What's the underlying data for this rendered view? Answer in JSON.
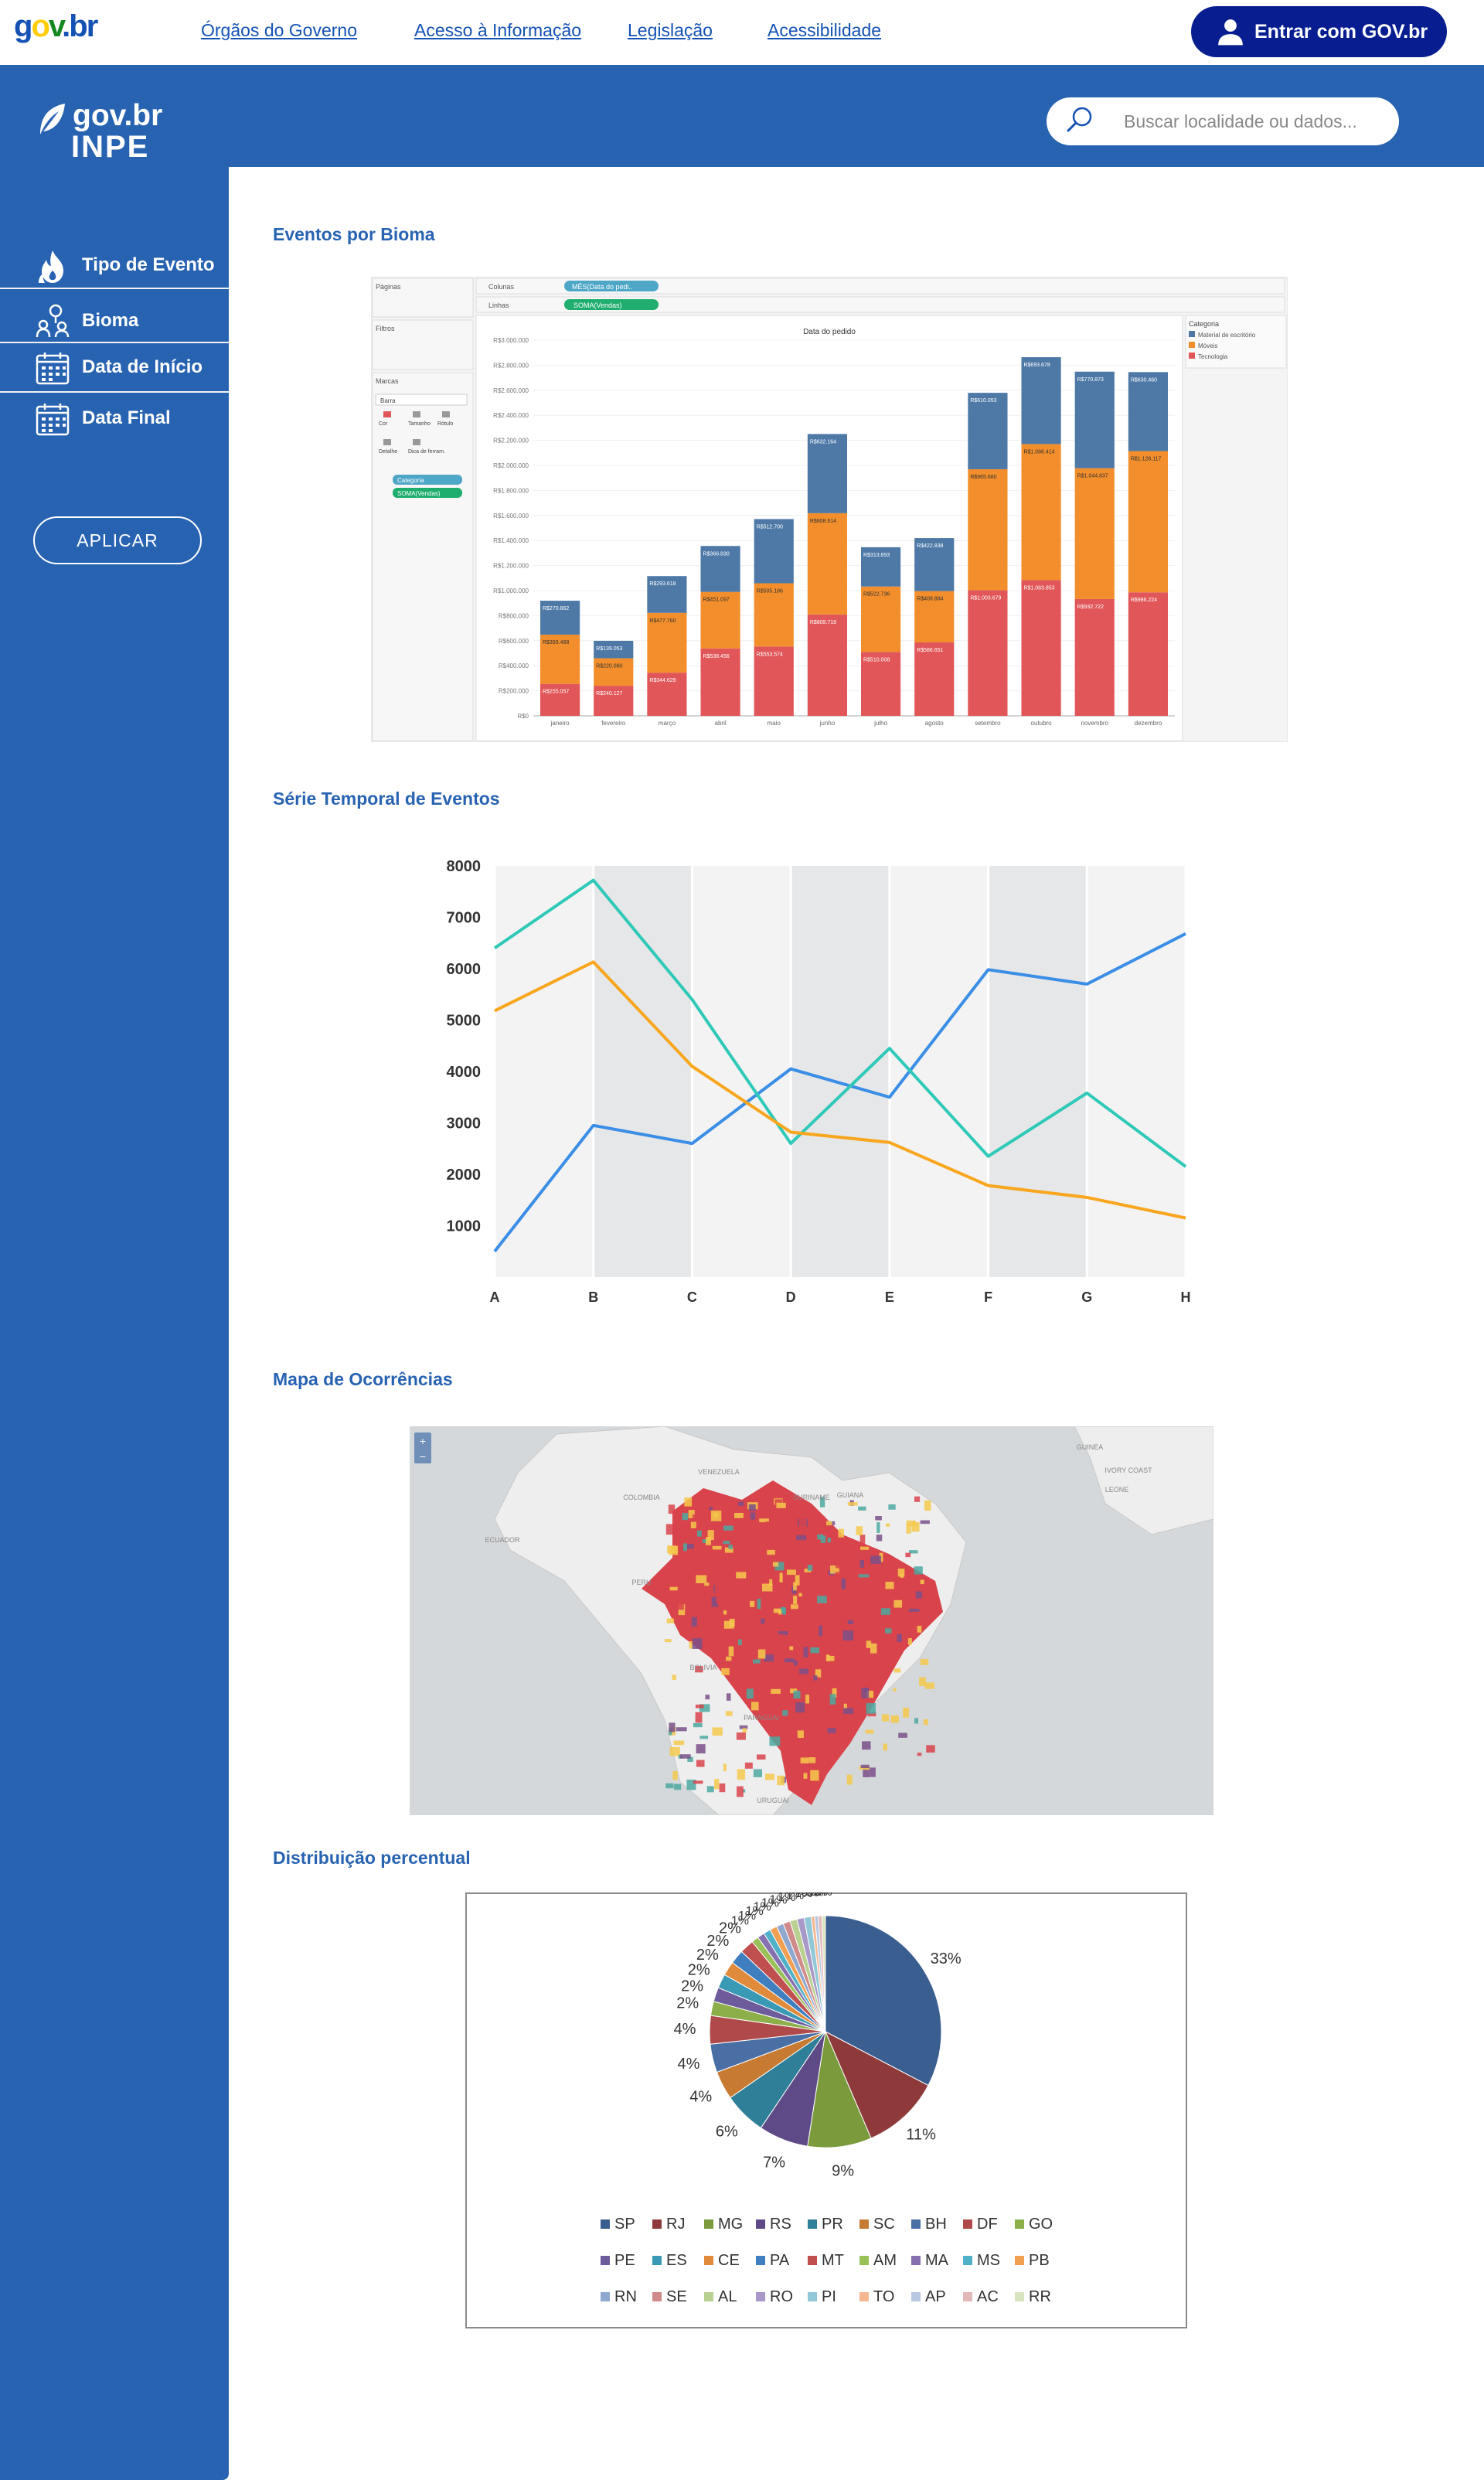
{
  "topbar": {
    "logo": {
      "g": "g",
      "o": "o",
      "v": "v",
      "b": ".br"
    },
    "links": [
      "Órgãos do Governo",
      "Acesso à Informação",
      "Legislação",
      "Acessibilidade"
    ],
    "login_label": "Entrar com GOV.br"
  },
  "header": {
    "logo_line1": "gov.br",
    "logo_line2": "INPE",
    "search_placeholder": "Buscar localidade ou dados..."
  },
  "sidebar": {
    "items": [
      {
        "label": "Tipo de Evento",
        "icon": "fire-icon"
      },
      {
        "label": "Bioma",
        "icon": "tree-people-icon"
      },
      {
        "label": "Data de Início",
        "icon": "calendar-icon"
      },
      {
        "label": "Data Final",
        "icon": "calendar-icon"
      }
    ],
    "apply_label": "APLICAR"
  },
  "sections": {
    "bioma": "Eventos por Bioma",
    "serie": "Série Temporal de Eventos",
    "mapa": "Mapa de Ocorrências",
    "distribuicao": "Distribuição percentual"
  },
  "tableau": {
    "shelf_pages": "Páginas",
    "shelf_filters": "Filtros",
    "shelf_marks": "Marcas",
    "marks_type": "Barra",
    "marks_buttons": [
      "Cor",
      "Tamanho",
      "Rótulo",
      "Detalhe",
      "Dica de ferram."
    ],
    "pill_category": "Categoria",
    "pill_sum": "SOMA(Vendas)",
    "columns_label": "Colunas",
    "rows_label": "Linhas",
    "columns_pill": "MÊS(Data do pedi..",
    "rows_pill": "SOMA(Vendas)",
    "legend_title": "Categoria",
    "colors": {
      "escritorio": "#4e79a7",
      "moveis": "#f28e2b",
      "tecnologia": "#e15759"
    }
  },
  "chart_data": [
    {
      "type": "bar",
      "stacked": true,
      "title": "Data do pedido",
      "categories": [
        "janeiro",
        "fevereiro",
        "março",
        "abril",
        "maio",
        "junho",
        "julho",
        "agosto",
        "setembro",
        "outubro",
        "novembro",
        "dezembro"
      ],
      "series": [
        {
          "name": "Tecnologia",
          "values": [
            255057,
            240127,
            344629,
            538456,
            553574,
            809719,
            510008,
            586651,
            1003679,
            1083853,
            932722,
            986224
          ],
          "labels": [
            "R$255.057",
            "R$240.127",
            "R$344.629",
            "R$538.456",
            "R$553.574",
            "R$809.719",
            "R$510.008",
            "R$586.651",
            "R$1.003.679",
            "R$1.083.853",
            "R$932.722",
            "R$986.224"
          ]
        },
        {
          "name": "Móveis",
          "values": [
            393488,
            220080,
            477760,
            451097,
            505186,
            808614,
            522736,
            409884,
            965680,
            1086414,
            1044837,
            1128117
          ],
          "labels": [
            "R$393.488",
            "R$220.080",
            "R$477.760",
            "R$451.097",
            "R$505.186",
            "R$808.614",
            "R$522.736",
            "R$409.884",
            "R$965.680",
            "R$1.086.414",
            "R$1.044.837",
            "R$1.128.117"
          ]
        },
        {
          "name": "Material de escritório",
          "values": [
            270862,
            139053,
            293618,
            366830,
            512700,
            632164,
            313893,
            422838,
            610053,
            693678,
            770873,
            630460
          ],
          "labels": [
            "R$270.862",
            "R$139.053",
            "R$293.618",
            "R$366.830",
            "R$512.700",
            "R$632.164",
            "R$313.893",
            "R$422.838",
            "R$610.053",
            "R$693.678",
            "R$770.873",
            "R$630.460"
          ]
        }
      ],
      "ylim": [
        0,
        3000000
      ],
      "yticks": [
        "R$0",
        "R$200.000",
        "R$400.000",
        "R$600.000",
        "R$800.000",
        "R$1.000.000",
        "R$1.200.000",
        "R$1.400.000",
        "R$1.600.000",
        "R$1.800.000",
        "R$2.000.000",
        "R$2.200.000",
        "R$2.400.000",
        "R$2.600.000",
        "R$2.800.000",
        "R$3.000.000"
      ],
      "legend_placement": "right"
    },
    {
      "type": "line",
      "x": [
        "A",
        "B",
        "C",
        "D",
        "E",
        "F",
        "G",
        "H"
      ],
      "series": [
        {
          "color": "#3a8ee6",
          "values": [
            500,
            2950,
            2600,
            4050,
            3500,
            5980,
            5700,
            6680
          ]
        },
        {
          "color": "#2ec9b8",
          "values": [
            6400,
            7720,
            5400,
            2600,
            4450,
            2350,
            3580,
            2150
          ]
        },
        {
          "color": "#f8a61e",
          "values": [
            5180,
            6130,
            4100,
            2820,
            2620,
            1780,
            1550,
            1150
          ]
        }
      ],
      "ylim": [
        0,
        8000
      ],
      "yticks": [
        1000,
        2000,
        3000,
        4000,
        5000,
        6000,
        7000,
        8000
      ],
      "grid": true
    },
    {
      "type": "pie",
      "labels": [
        "SP",
        "RJ",
        "MG",
        "RS",
        "PR",
        "SC",
        "BH",
        "DF",
        "GO",
        "PE",
        "ES",
        "CE",
        "PA",
        "MT",
        "AM",
        "MA",
        "MS",
        "PB",
        "RN",
        "SE",
        "AL",
        "RO",
        "PI",
        "TO",
        "AP",
        "AC",
        "RR"
      ],
      "values": [
        33,
        11,
        9,
        7,
        6,
        4,
        4,
        4,
        2,
        2,
        2,
        2,
        2,
        2,
        1,
        1,
        1,
        1,
        1,
        1,
        1,
        1,
        1,
        0.5,
        0.5,
        0.5,
        0.5
      ],
      "data_labels": [
        "33%",
        "11%",
        "9%",
        "7%",
        "6%",
        "4%",
        "4%",
        "4%",
        "2%",
        "2%",
        "2%",
        "2%",
        "2%",
        "2%",
        "1%",
        "1%",
        "1%",
        "1%",
        "1%",
        "1%",
        "1%",
        "1%",
        "1%",
        "0%",
        "0%",
        "0%",
        "0%"
      ],
      "colors": [
        "#3a5e8f",
        "#8e3a3a",
        "#7a9a3c",
        "#5e4a86",
        "#2f7f98",
        "#c77a32",
        "#4a6fa5",
        "#b04a4a",
        "#8caf4a",
        "#6e5b9b",
        "#3a9ab5",
        "#e08a3c",
        "#3f7fc0",
        "#c04f4f",
        "#9ac058",
        "#8670b0",
        "#4fb0c8",
        "#f0a050",
        "#8fa8d0",
        "#d08a8a",
        "#b8d090",
        "#a898c8",
        "#90c8d8",
        "#f4b890",
        "#b8c8e0",
        "#e0b8b8",
        "#d8e4c0"
      ],
      "legend_placement": "bottom"
    }
  ],
  "map": {
    "labels": [
      "VENEZUELA",
      "COLOMBIA",
      "SURINAME",
      "GUIANA",
      "GUINEA",
      "ECUADOR",
      "PERU",
      "BOLIVIA",
      "PARAGUAI",
      "URUGUAI",
      "IVORY COAST",
      "LEONE"
    ],
    "zoom": [
      "+",
      "−"
    ],
    "colors": {
      "red": "#d9434b",
      "yellow": "#f5c94c",
      "teal": "#4ba8a0",
      "purple": "#7a4f8a"
    }
  }
}
